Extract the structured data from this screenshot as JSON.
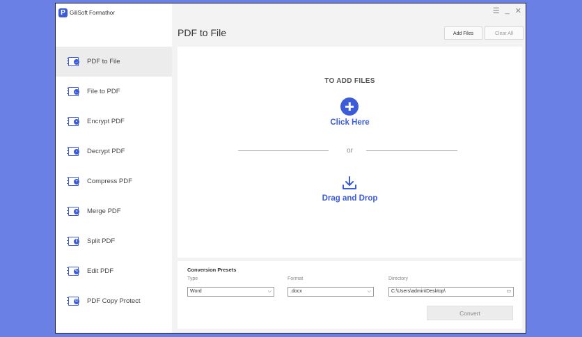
{
  "app": {
    "title": "GiliSoft Formathor",
    "logo_letter": "P"
  },
  "sidebar": {
    "items": [
      {
        "label": "PDF to File",
        "icon": "arrow-right",
        "active": true
      },
      {
        "label": "File to PDF",
        "icon": "arrow-left"
      },
      {
        "label": "Encrypt PDF",
        "icon": "lock"
      },
      {
        "label": "Decrypt PDF",
        "icon": "unlock"
      },
      {
        "label": "Compress PDF",
        "icon": "compress"
      },
      {
        "label": "Merge PDF",
        "icon": "merge"
      },
      {
        "label": "Split PDF",
        "icon": "split"
      },
      {
        "label": "Edit PDF",
        "icon": "edit"
      },
      {
        "label": "PDF Copy Protect",
        "icon": "copy-protect"
      }
    ]
  },
  "window_controls": {
    "menu": "☰",
    "minimize": "_",
    "close": "✕"
  },
  "header": {
    "title": "PDF to File",
    "add_files": "Add Files",
    "clear_all": "Clear All"
  },
  "dropzone": {
    "heading": "TO ADD FILES",
    "click_here": "Click Here",
    "or": "or",
    "drag_drop": "Drag and Drop"
  },
  "presets": {
    "title": "Conversion Presets",
    "type_label": "Type",
    "type_value": "Word",
    "format_label": "Format",
    "format_value": ".docx",
    "directory_label": "Directory",
    "directory_value": "C:\\Users\\admin\\Desktop\\",
    "convert": "Convert"
  },
  "colors": {
    "accent": "#3c5bd8",
    "background": "#6a80e4"
  }
}
